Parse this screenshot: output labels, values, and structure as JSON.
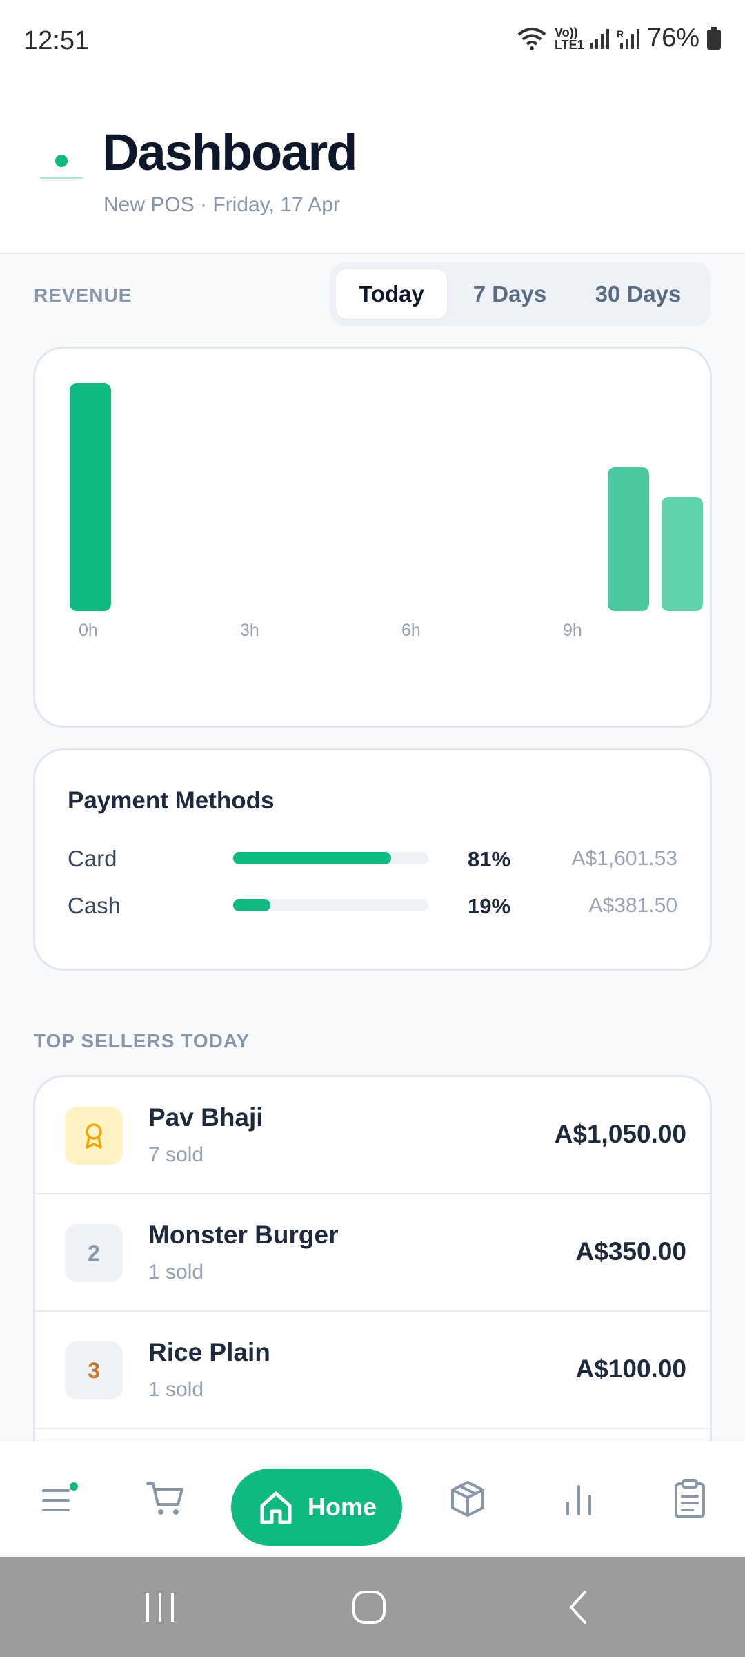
{
  "status_bar": {
    "time": "12:51",
    "network": "Vo)) LTE1",
    "battery": "76%"
  },
  "header": {
    "title": "Dashboard",
    "subtitle": "New POS · Friday, 17 Apr"
  },
  "revenue": {
    "section_label": "REVENUE",
    "tabs": [
      {
        "label": "Today",
        "active": true
      },
      {
        "label": "7 Days",
        "active": false
      },
      {
        "label": "30 Days",
        "active": false
      }
    ]
  },
  "chart_data": {
    "type": "bar",
    "x_ticks": [
      "0h",
      "3h",
      "6h",
      "9h"
    ],
    "categories": [
      "0h",
      "10h",
      "11h"
    ],
    "values": [
      100,
      63,
      50
    ],
    "colors": [
      "#10b981",
      "#4ac9a0",
      "#5fd4aa"
    ],
    "ylim": [
      0,
      100
    ],
    "grid": false
  },
  "payment_methods": {
    "title": "Payment Methods",
    "items": [
      {
        "label": "Card",
        "percent": "81%",
        "fraction": 0.81,
        "amount": "A$1,601.53"
      },
      {
        "label": "Cash",
        "percent": "19%",
        "fraction": 0.19,
        "amount": "A$381.50"
      }
    ]
  },
  "top_sellers": {
    "section_label": "TOP SELLERS TODAY",
    "items": [
      {
        "rank": "",
        "icon": "award-icon",
        "name": "Pav Bhaji",
        "sold": "7 sold",
        "amount": "A$1,050.00"
      },
      {
        "rank": "2",
        "name": "Monster Burger",
        "sold": "1 sold",
        "amount": "A$350.00"
      },
      {
        "rank": "3",
        "name": "Rice Plain",
        "sold": "1 sold",
        "amount": "A$100.00"
      }
    ]
  },
  "bottom_nav": {
    "items": [
      {
        "icon": "menu-icon"
      },
      {
        "icon": "cart-icon"
      },
      {
        "icon": "home-icon",
        "label": "Home",
        "active": true
      },
      {
        "icon": "box-icon"
      },
      {
        "icon": "bar-chart-icon"
      },
      {
        "icon": "clipboard-icon"
      }
    ]
  },
  "colors": {
    "accent": "#10b981",
    "background": "#f7f9fb",
    "gold": "#f5c518"
  }
}
